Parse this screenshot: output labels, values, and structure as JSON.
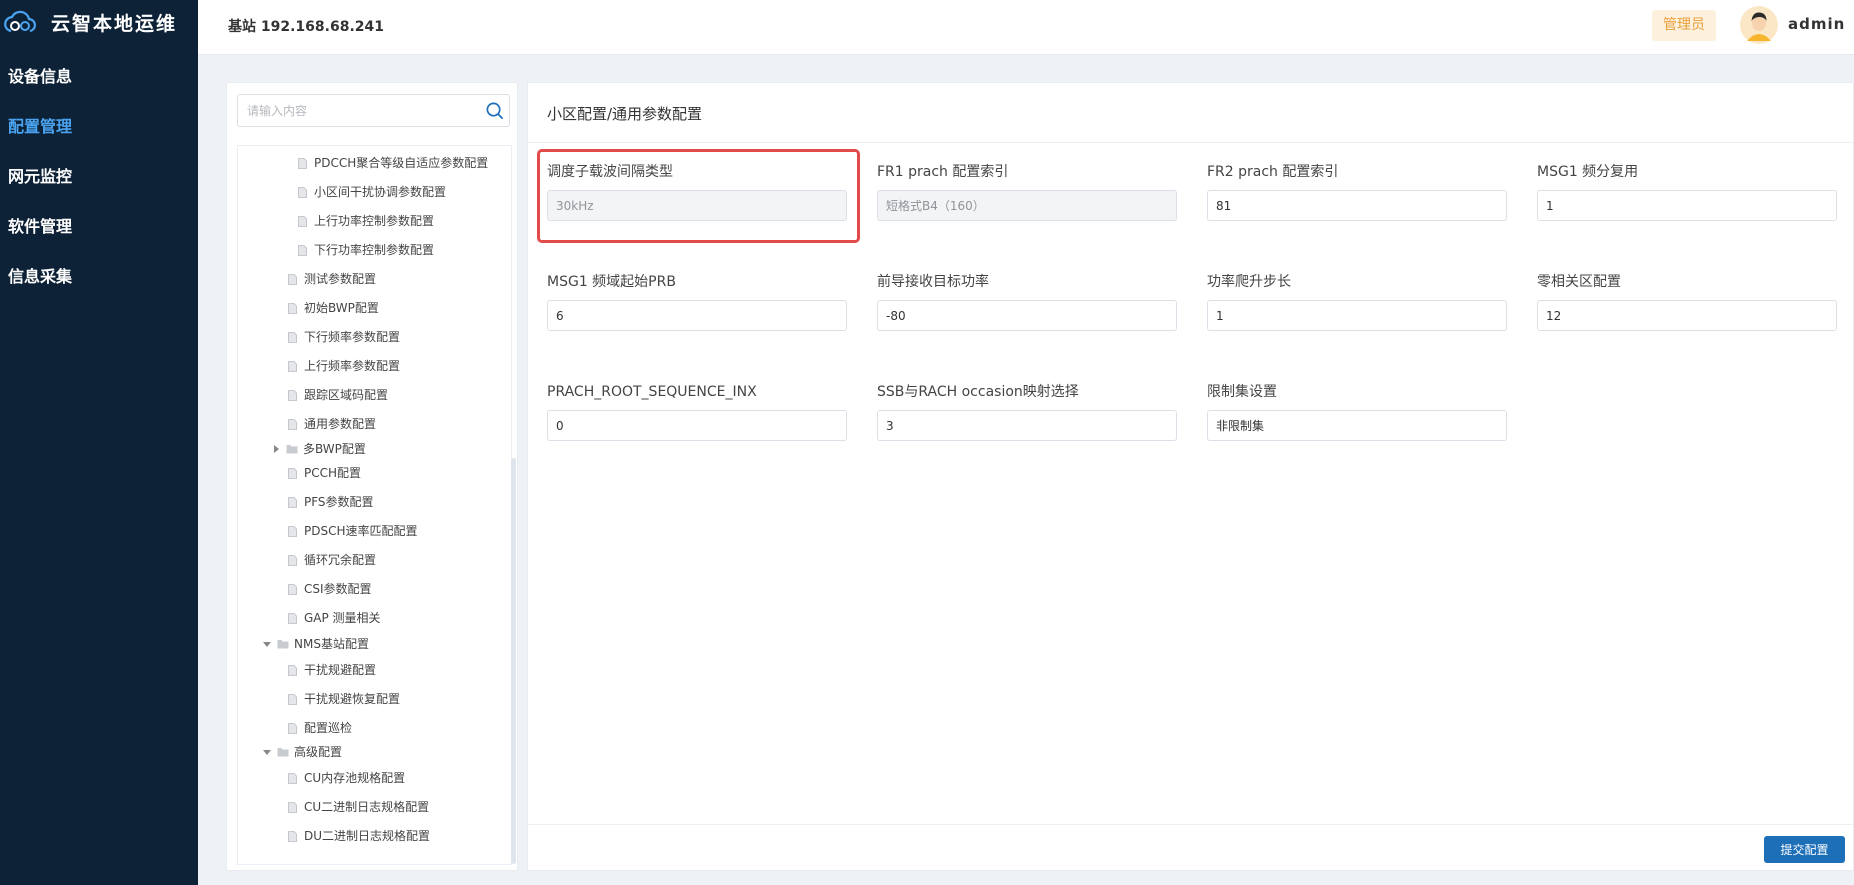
{
  "app": {
    "title": "云智本地运维"
  },
  "nav": [
    {
      "label": "设备信息",
      "active": false
    },
    {
      "label": "配置管理",
      "active": true
    },
    {
      "label": "网元监控",
      "active": false
    },
    {
      "label": "软件管理",
      "active": false
    },
    {
      "label": "信息采集",
      "active": false
    }
  ],
  "header": {
    "title": "基站 192.168.68.241",
    "role": "管理员",
    "user": "admin"
  },
  "search": {
    "placeholder": "请输入内容"
  },
  "tree": [
    {
      "label": "PDCCH聚合等级自适应参数配置",
      "type": "doc",
      "level": 3
    },
    {
      "label": "小区间干扰协调参数配置",
      "type": "doc",
      "level": 3
    },
    {
      "label": "上行功率控制参数配置",
      "type": "doc",
      "level": 3
    },
    {
      "label": "下行功率控制参数配置",
      "type": "doc",
      "level": 3
    },
    {
      "label": "测试参数配置",
      "type": "doc",
      "level": 2
    },
    {
      "label": "初始BWP配置",
      "type": "doc",
      "level": 2
    },
    {
      "label": "下行频率参数配置",
      "type": "doc",
      "level": 2
    },
    {
      "label": "上行频率参数配置",
      "type": "doc",
      "level": 2
    },
    {
      "label": "跟踪区域码配置",
      "type": "doc",
      "level": 2
    },
    {
      "label": "通用参数配置",
      "type": "doc",
      "level": 2
    },
    {
      "label": "多BWP配置",
      "type": "folder-collapsed",
      "level": 1
    },
    {
      "label": "PCCH配置",
      "type": "doc",
      "level": 2
    },
    {
      "label": "PFS参数配置",
      "type": "doc",
      "level": 2
    },
    {
      "label": "PDSCH速率匹配配置",
      "type": "doc",
      "level": 2
    },
    {
      "label": "循环冗余配置",
      "type": "doc",
      "level": 2
    },
    {
      "label": "CSI参数配置",
      "type": "doc",
      "level": 2
    },
    {
      "label": "GAP 测量相关",
      "type": "doc",
      "level": 2
    },
    {
      "label": "NMS基站配置",
      "type": "folder-open",
      "level": 0
    },
    {
      "label": "干扰规避配置",
      "type": "doc",
      "level": 2
    },
    {
      "label": "干扰规避恢复配置",
      "type": "doc",
      "level": 2
    },
    {
      "label": "配置巡检",
      "type": "doc",
      "level": 2
    },
    {
      "label": "高级配置",
      "type": "folder-open",
      "level": 0
    },
    {
      "label": "CU内存池规格配置",
      "type": "doc",
      "level": 2
    },
    {
      "label": "CU二进制日志规格配置",
      "type": "doc",
      "level": 2
    },
    {
      "label": "DU二进制日志规格配置",
      "type": "doc",
      "level": 2
    }
  ],
  "content": {
    "breadcrumb": "小区配置/通用参数配置",
    "fields": [
      {
        "label": "调度子载波间隔类型",
        "value": "30kHz",
        "disabled": true
      },
      {
        "label": "FR1 prach 配置索引",
        "value": "短格式B4（160）",
        "disabled": true
      },
      {
        "label": "FR2 prach 配置索引",
        "value": "81",
        "disabled": false
      },
      {
        "label": "MSG1 频分复用",
        "value": "1",
        "disabled": false
      },
      {
        "label": "MSG1 频域起始PRB",
        "value": "6",
        "disabled": false
      },
      {
        "label": "前导接收目标功率",
        "value": "-80",
        "disabled": false
      },
      {
        "label": "功率爬升步长",
        "value": "1",
        "disabled": false
      },
      {
        "label": "零相关区配置",
        "value": "12",
        "disabled": false
      },
      {
        "label": "PRACH_ROOT_SEQUENCE_INX",
        "value": "0",
        "disabled": false
      },
      {
        "label": "SSB与RACH occasion映射选择",
        "value": "3",
        "disabled": false
      },
      {
        "label": "限制集设置",
        "value": "非限制集",
        "disabled": false
      }
    ],
    "submit_label": "提交配置"
  },
  "colors": {
    "sidebar": "#0d2236",
    "accent": "#4aa3f0",
    "highlight": "#e34b4b",
    "primary_button": "#1d6fb8"
  }
}
